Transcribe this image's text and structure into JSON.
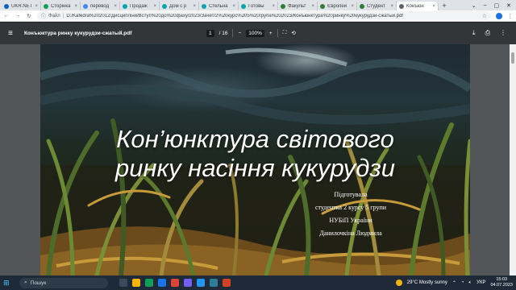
{
  "tabs": [
    {
      "label": "UKR.NET",
      "color": "#0b61c4"
    },
    {
      "label": "Сторінка",
      "color": "#0f9d58"
    },
    {
      "label": "перевод",
      "color": "#4285f4"
    },
    {
      "label": "Продаж",
      "color": "#00a5a8"
    },
    {
      "label": "Дом с р",
      "color": "#00a5a8"
    },
    {
      "label": "Стельна",
      "color": "#00a5a8"
    },
    {
      "label": "Готовы",
      "color": "#00a5a8"
    },
    {
      "label": "Факульт",
      "color": "#2e7d32"
    },
    {
      "label": "Європей",
      "color": "#2e7d32"
    },
    {
      "label": "Студент",
      "color": "#2e7d32"
    },
    {
      "label": "Конъюн",
      "color": "#5f6368",
      "active": true
    }
  ],
  "address": {
    "file_label": "Файл",
    "path": "D:/Kafedra%202012/Дисципліни/Вступ%20до%20фаху/2023/Зачет/2%20курс%205%20група%202023/Конъюнктура%20ринку%20кукурудзи-сжатый.pdf"
  },
  "pdf_toolbar": {
    "title": "Конъюктура ринку кукурудзи-сжатый.pdf",
    "current_page": "1",
    "total_pages": "/ 16",
    "zoom": "100%"
  },
  "slide": {
    "title_line1": "Кон’юнктура світового",
    "title_line2": "ринку насіння кукурудзи",
    "byline": [
      "Підготувала",
      "студентка 2 курсу 5 групи",
      "НУБіП України",
      "Данилочкіна Людмила"
    ]
  },
  "taskbar": {
    "search_label": "Пошук",
    "weather": "29°C  Mostly sunny",
    "language": "УКР",
    "time": "15:03",
    "date": "04.07.2023"
  }
}
